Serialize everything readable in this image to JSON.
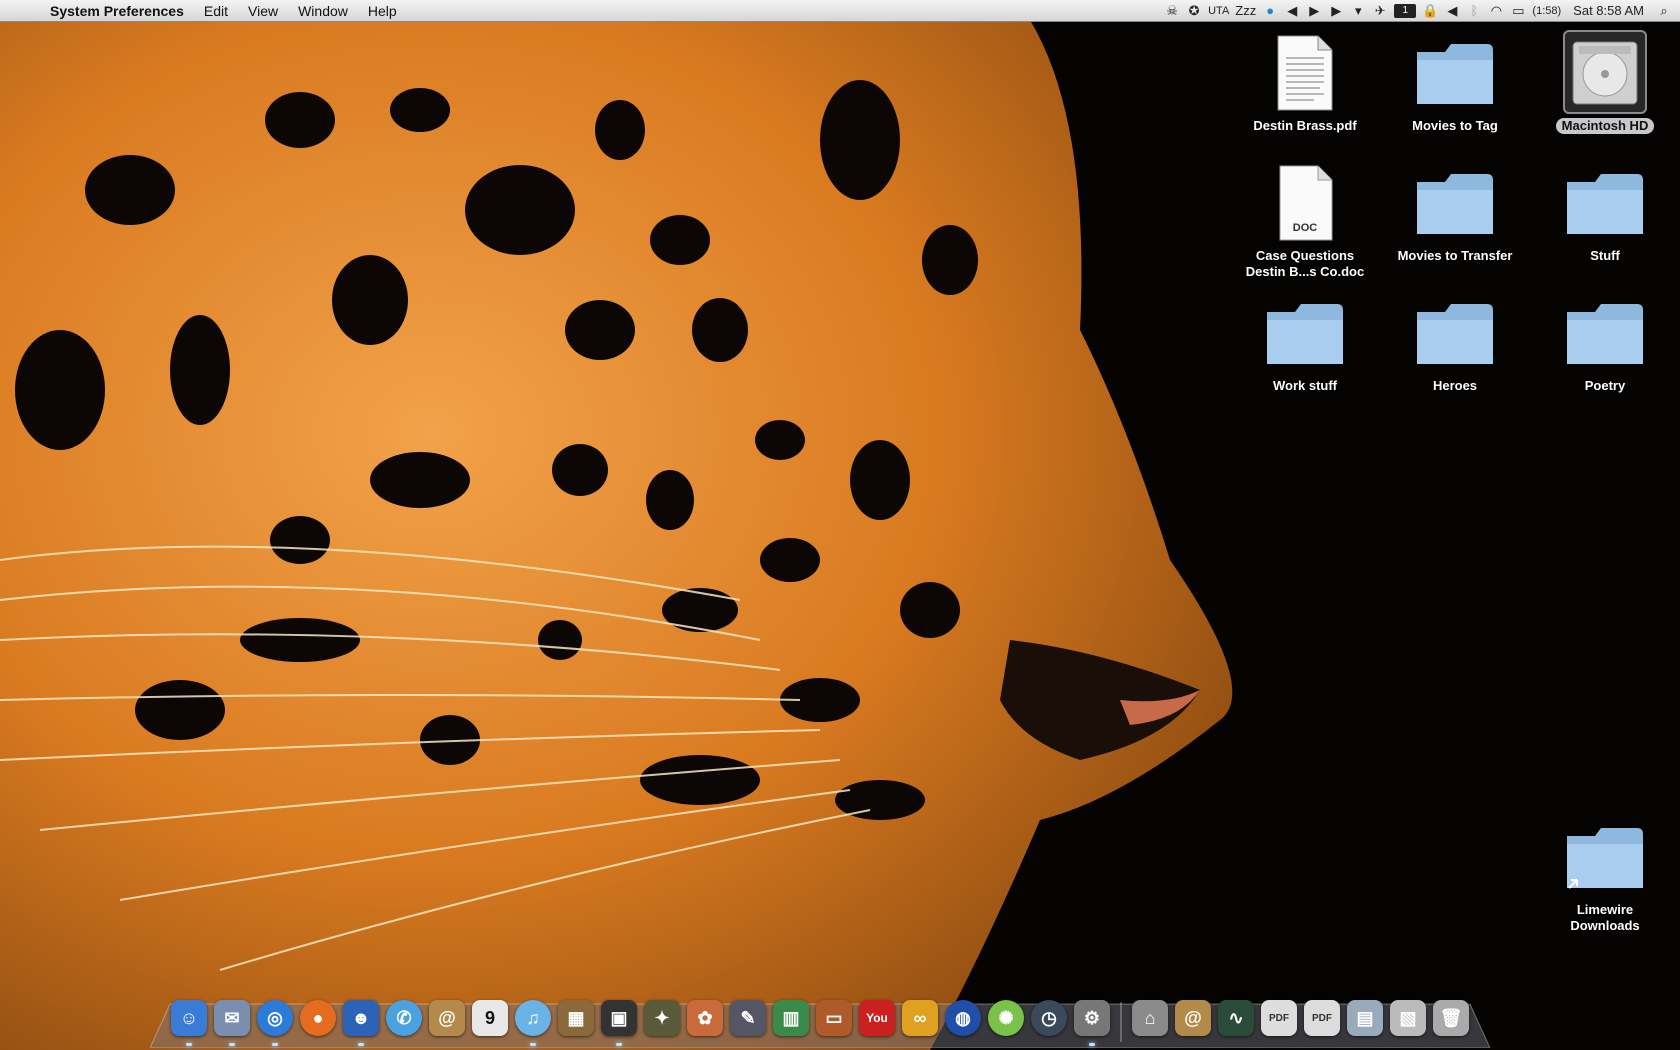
{
  "menubar": {
    "apple_glyph": "",
    "app_name": "System Preferences",
    "menus": [
      "Edit",
      "View",
      "Window",
      "Help"
    ],
    "status": {
      "input_label": "UTA",
      "sleep_label": "Zzz",
      "display_label": "1",
      "battery_time": "(1:58)",
      "clock": "Sat 8:58 AM"
    },
    "status_icons": [
      "alien-icon",
      "compass-icon",
      "sleep-icon",
      "weather-icon",
      "rewind-icon",
      "play-icon",
      "forward-icon",
      "dropdown-icon",
      "bird-icon",
      "display-icon",
      "lock-icon",
      "volume-icon",
      "bluetooth-icon",
      "wifi-icon",
      "battery-icon",
      "spotlight-icon"
    ]
  },
  "desktop": {
    "icons": [
      {
        "id": "destin-brass-pdf",
        "label": "Destin Brass.pdf",
        "type": "pdf"
      },
      {
        "id": "movies-to-tag",
        "label": "Movies to Tag",
        "type": "folder"
      },
      {
        "id": "macintosh-hd",
        "label": "Macintosh HD",
        "type": "drive",
        "selected": true
      },
      {
        "id": "case-questions-doc",
        "label": "Case Questions Destin B...s Co.doc",
        "type": "doc",
        "badge": "DOC"
      },
      {
        "id": "movies-to-transfer",
        "label": "Movies to Transfer",
        "type": "folder"
      },
      {
        "id": "stuff",
        "label": "Stuff",
        "type": "folder"
      },
      {
        "id": "work-stuff",
        "label": "Work stuff",
        "type": "folder"
      },
      {
        "id": "heroes",
        "label": "Heroes",
        "type": "folder"
      },
      {
        "id": "poetry",
        "label": "Poetry",
        "type": "folder"
      },
      {
        "id": "limewire-downloads",
        "label": "Limewire Downloads",
        "type": "folder-alias"
      }
    ]
  },
  "dock": {
    "apps": [
      {
        "name": "finder",
        "glyph": "☺",
        "color": "#3a7bd5",
        "running": true
      },
      {
        "name": "mail-stamp",
        "glyph": "✉",
        "color": "#7a8fb0",
        "running": true
      },
      {
        "name": "safari",
        "glyph": "◎",
        "color": "#2d7bd8",
        "running": true
      },
      {
        "name": "firefox",
        "glyph": "●",
        "color": "#e56b1f",
        "running": false
      },
      {
        "name": "adium",
        "glyph": "☻",
        "color": "#2a63b8",
        "running": true
      },
      {
        "name": "ichat",
        "glyph": "✆",
        "color": "#4aa3e0",
        "running": false
      },
      {
        "name": "address-book",
        "glyph": "@",
        "color": "#b48a4a",
        "running": false
      },
      {
        "name": "ical",
        "glyph": "9",
        "color": "#e8e8e8",
        "running": false
      },
      {
        "name": "itunes",
        "glyph": "♫",
        "color": "#6ab3e6",
        "running": true
      },
      {
        "name": "iphoto",
        "glyph": "▦",
        "color": "#8a6a3a",
        "running": false
      },
      {
        "name": "photo-booth",
        "glyph": "▣",
        "color": "#333",
        "running": true
      },
      {
        "name": "growl",
        "glyph": "✦",
        "color": "#5a5a3a",
        "running": false
      },
      {
        "name": "bowtie",
        "glyph": "✿",
        "color": "#c96a3a",
        "running": false
      },
      {
        "name": "script-editor",
        "glyph": "✎",
        "color": "#556",
        "running": false
      },
      {
        "name": "numbers",
        "glyph": "▥",
        "color": "#3a8a4a",
        "running": false
      },
      {
        "name": "keynote",
        "glyph": "▭",
        "color": "#b05a2a",
        "running": false
      },
      {
        "name": "youtube",
        "glyph": "You",
        "color": "#cc1f1f",
        "running": false
      },
      {
        "name": "quartz-composer",
        "glyph": "∞",
        "color": "#e0a020",
        "running": false
      },
      {
        "name": "google-earth",
        "glyph": "◍",
        "color": "#1f4fa8",
        "running": false
      },
      {
        "name": "limewire",
        "glyph": "✺",
        "color": "#7bc24a",
        "running": false
      },
      {
        "name": "time-machine",
        "glyph": "◷",
        "color": "#3a4a5a",
        "running": false
      },
      {
        "name": "system-preferences",
        "glyph": "⚙",
        "color": "#777",
        "running": true
      }
    ],
    "docs": [
      {
        "name": "home-folder",
        "glyph": "⌂",
        "color": "#8a8a8a"
      },
      {
        "name": "address-stack",
        "glyph": "@",
        "color": "#b48a4a"
      },
      {
        "name": "activity-monitor",
        "glyph": "∿",
        "color": "#2a4a3a"
      },
      {
        "name": "pdf-stack-1",
        "glyph": "PDF",
        "color": "#ddd"
      },
      {
        "name": "pdf-stack-2",
        "glyph": "PDF",
        "color": "#ddd"
      },
      {
        "name": "screenshots",
        "glyph": "▤",
        "color": "#9ab"
      },
      {
        "name": "downloads-stack",
        "glyph": "▧",
        "color": "#bbb"
      },
      {
        "name": "trash",
        "glyph": "🗑",
        "color": "#aaa"
      }
    ]
  }
}
